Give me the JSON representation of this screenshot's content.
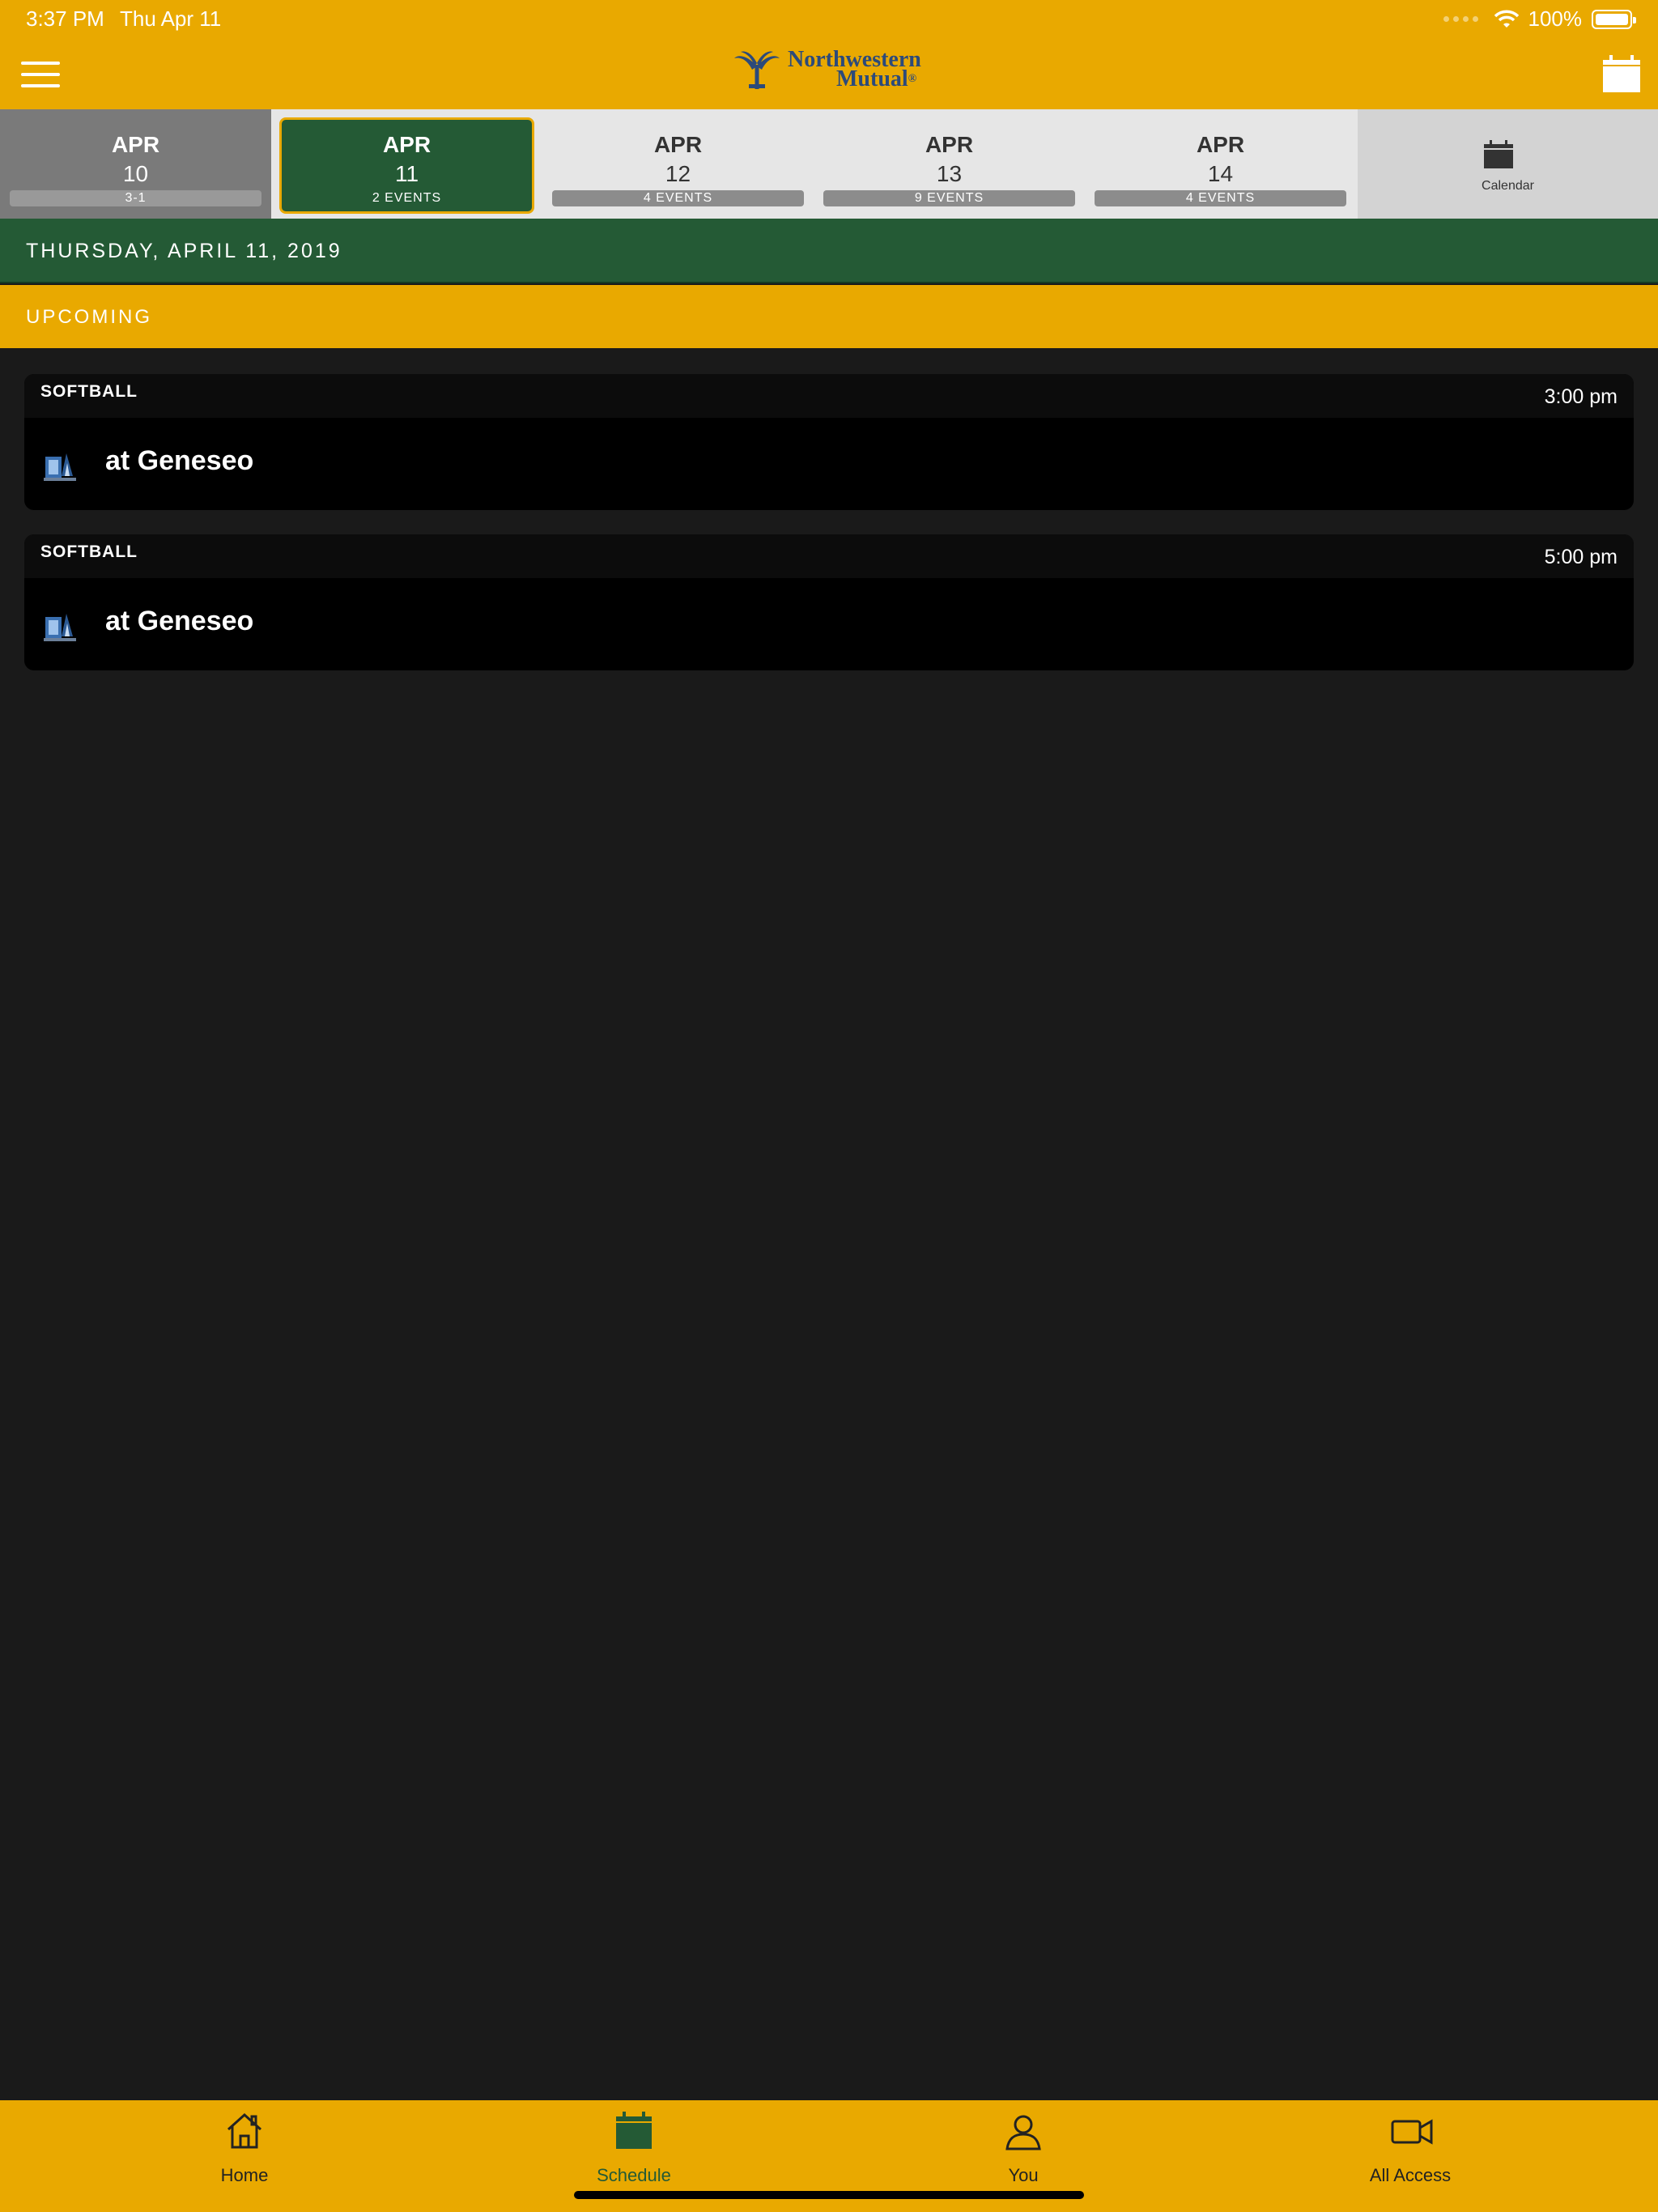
{
  "status": {
    "time": "3:37 PM",
    "date": "Thu Apr 11",
    "battery": "100%"
  },
  "header": {
    "logo_line1": "Northwestern",
    "logo_line2": "Mutual",
    "logo_mark": "®"
  },
  "date_strip": [
    {
      "month": "APR",
      "day": "10",
      "badge": "3-1"
    },
    {
      "month": "APR",
      "day": "11",
      "badge": "2 EVENTS"
    },
    {
      "month": "APR",
      "day": "12",
      "badge": "4 EVENTS"
    },
    {
      "month": "APR",
      "day": "13",
      "badge": "9 EVENTS"
    },
    {
      "month": "APR",
      "day": "14",
      "badge": "4 EVENTS"
    }
  ],
  "calendar_label": "Calendar",
  "day_heading": "THURSDAY, APRIL 11, 2019",
  "section_heading": "UPCOMING",
  "events": [
    {
      "sport": "SOFTBALL",
      "time": "3:00 pm",
      "opponent": "at Geneseo"
    },
    {
      "sport": "SOFTBALL",
      "time": "5:00 pm",
      "opponent": "at Geneseo"
    }
  ],
  "tabs": [
    {
      "label": "Home",
      "icon": "home-icon"
    },
    {
      "label": "Schedule",
      "icon": "calendar-icon"
    },
    {
      "label": "You",
      "icon": "person-icon"
    },
    {
      "label": "All Access",
      "icon": "video-camera-icon"
    }
  ],
  "colors": {
    "brand_gold": "#e9a900",
    "brand_green": "#245a35",
    "background": "#1a1a1a"
  }
}
